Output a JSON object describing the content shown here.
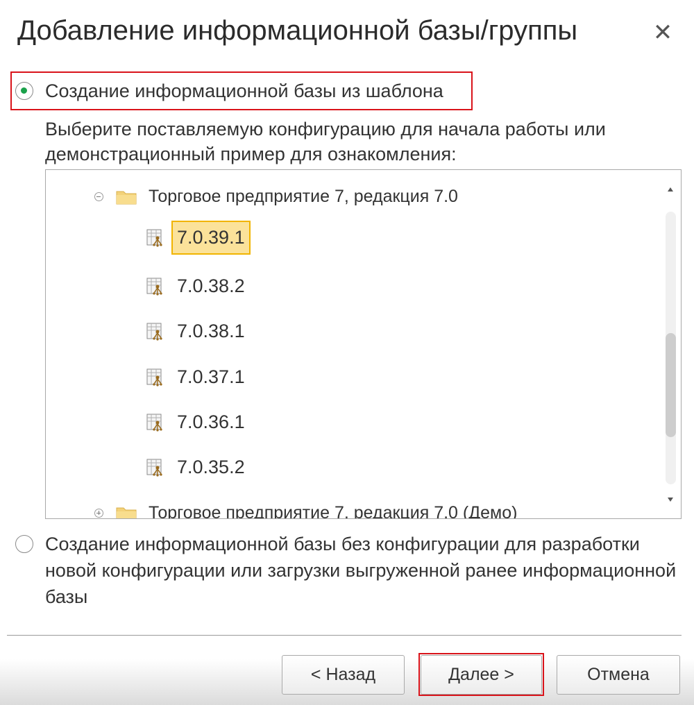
{
  "dialog": {
    "title": "Добавление информационной базы/группы",
    "close_icon": "close-icon"
  },
  "option_template": {
    "label": "Создание информационной базы из шаблона",
    "selected": true,
    "hint": "Выберите поставляемую конфигурацию для начала работы или демонстрационный пример для ознакомления:"
  },
  "tree": {
    "group_expanded": "Торговое предприятие 7, редакция 7.0",
    "versions": [
      "7.0.39.1",
      "7.0.38.2",
      "7.0.38.1",
      "7.0.37.1",
      "7.0.36.1",
      "7.0.35.2"
    ],
    "selected_version": "7.0.39.1",
    "group_collapsed": "Торговое предприятие 7, редакция 7.0 (Демо)"
  },
  "option_empty": {
    "label": "Создание информационной базы без конфигурации для разработки новой конфигурации или загрузки выгруженной ранее информационной базы",
    "selected": false
  },
  "buttons": {
    "back": "< Назад",
    "next": "Далее >",
    "cancel": "Отмена"
  },
  "colors": {
    "highlight": "#d9131a",
    "selection_fill": "#fbe29a",
    "selection_border": "#f1b400",
    "radio_dot": "#1aa14a"
  }
}
